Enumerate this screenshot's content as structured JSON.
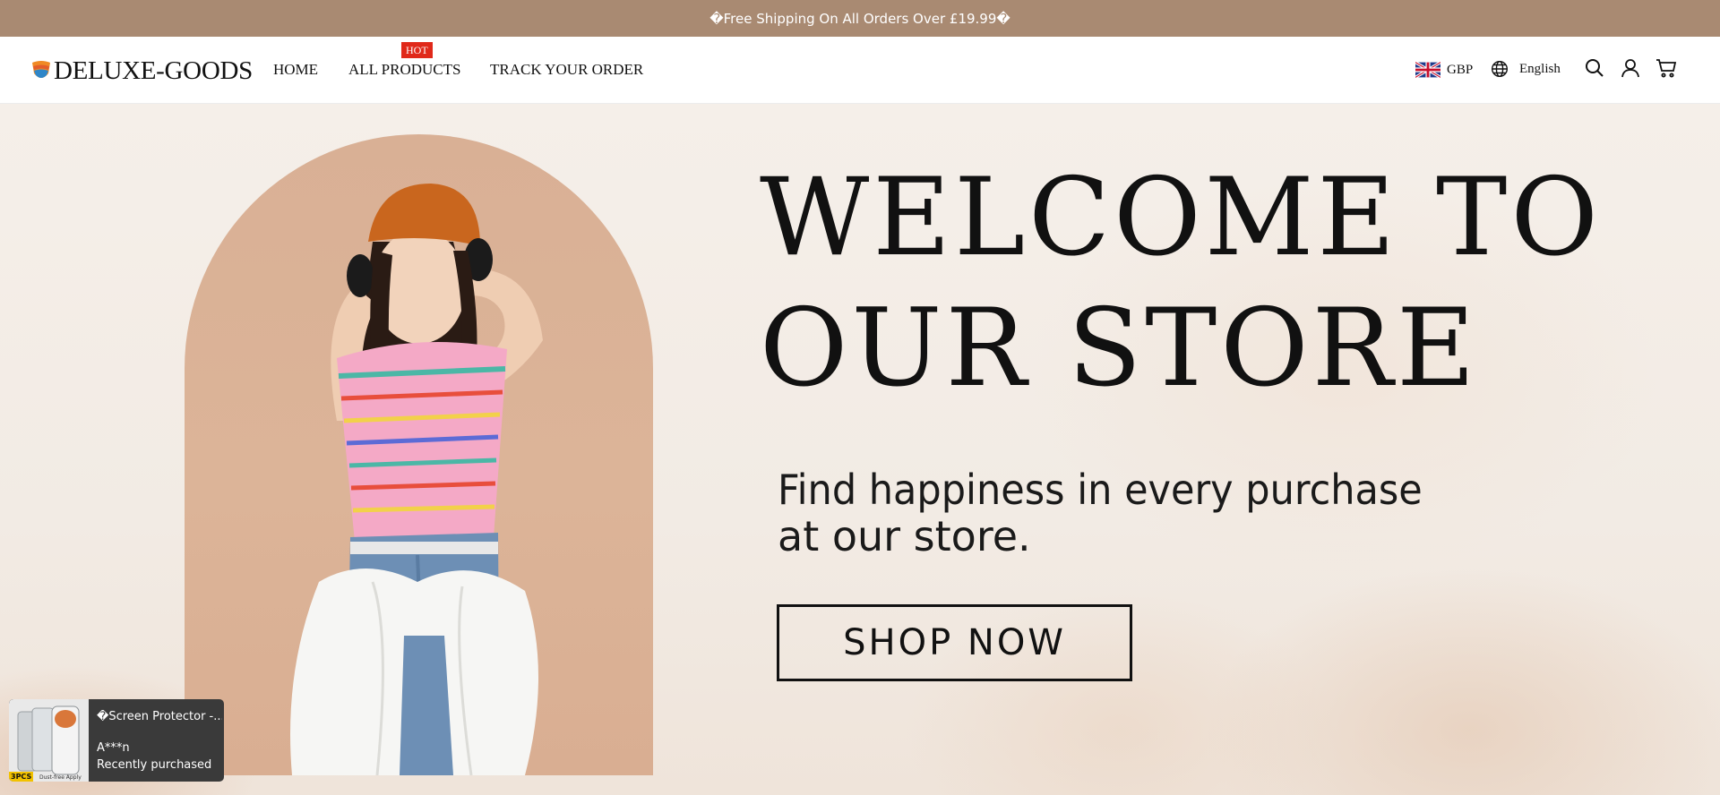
{
  "announcement": {
    "text": "�Free Shipping On All Orders Over £19.99�"
  },
  "header": {
    "logo_text": "DELUXE-GOODS",
    "nav": [
      {
        "label": "HOME"
      },
      {
        "label": "ALL PRODUCTS",
        "badge": "HOT"
      },
      {
        "label": "TRACK YOUR ORDER"
      }
    ],
    "currency": "GBP",
    "language": "English",
    "icons": [
      "search-icon",
      "account-icon",
      "cart-icon"
    ]
  },
  "hero": {
    "headline_line1": "WELCOME TO",
    "headline_line2": "OUR STORE",
    "subtitle_line1": "Find happiness in every purchase",
    "subtitle_line2": "at our store.",
    "cta_label": "SHOP NOW"
  },
  "toast": {
    "product": "�Screen Protector -...",
    "user": "A***n",
    "status": "Recently purchased",
    "thumb_badge": "3PCS",
    "thumb_caption": "Dust-free Apply"
  },
  "colors": {
    "announcement_bg": "#a98a72",
    "arch_bg": "#d9b095",
    "hot_badge": "#e0291a",
    "toast_bg": "#3a3a3a"
  }
}
